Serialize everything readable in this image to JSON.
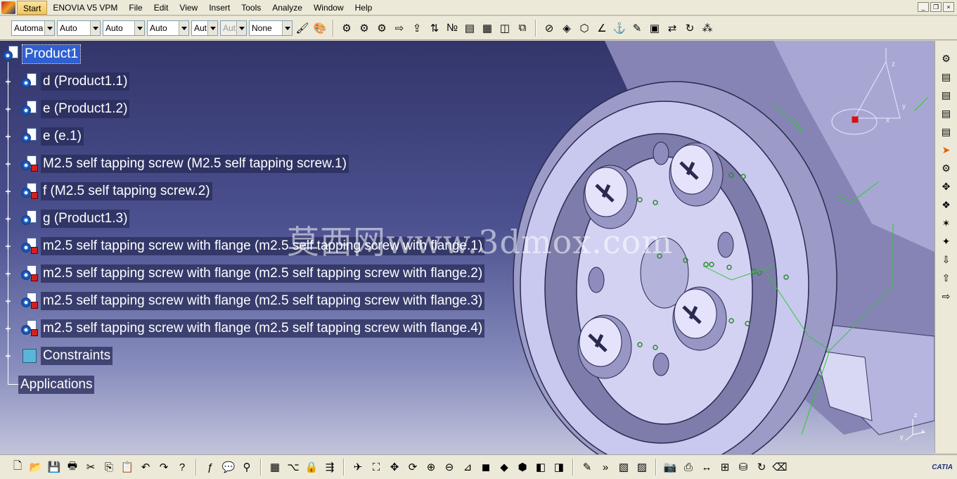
{
  "menu": {
    "start": "Start",
    "items": [
      "ENOVIA V5 VPM",
      "File",
      "Edit",
      "View",
      "Insert",
      "Tools",
      "Analyze",
      "Window",
      "Help"
    ]
  },
  "window_controls": [
    "_",
    "❐",
    "×"
  ],
  "toolbar": {
    "combos": [
      {
        "value": "Automa",
        "disabled": false
      },
      {
        "value": "Auto",
        "disabled": false
      },
      {
        "value": "Auto",
        "disabled": false
      },
      {
        "value": "Auto",
        "disabled": false
      },
      {
        "value": "Aut",
        "disabled": false
      },
      {
        "value": "Aut",
        "disabled": true
      },
      {
        "value": "None",
        "disabled": false
      }
    ]
  },
  "tree": {
    "root": "Product1",
    "children": [
      {
        "label": "d (Product1.1)",
        "icon": "product-icon"
      },
      {
        "label": "e (Product1.2)",
        "icon": "product-icon"
      },
      {
        "label": "e (e.1)",
        "icon": "product-icon"
      },
      {
        "label": "M2.5  self tapping screw (M2.5  self tapping screw.1)",
        "icon": "part-icon"
      },
      {
        "label": "f (M2.5  self tapping screw.2)",
        "icon": "part-icon"
      },
      {
        "label": "g (Product1.3)",
        "icon": "product-icon"
      },
      {
        "label": "m2.5 self tapping screw with flange (m2.5 self tapping screw with flange.1)",
        "icon": "part-icon"
      },
      {
        "label": "m2.5 self tapping screw with flange (m2.5 self tapping screw with flange.2)",
        "icon": "part-icon"
      },
      {
        "label": "m2.5 self tapping screw with flange (m2.5 self tapping screw with flange.3)",
        "icon": "part-icon"
      },
      {
        "label": "m2.5 self tapping screw with flange (m2.5 self tapping screw with flange.4)",
        "icon": "part-icon"
      },
      {
        "label": "Constraints",
        "icon": "constraints-icon"
      },
      {
        "label": "Applications",
        "icon": "none"
      }
    ]
  },
  "watermark": "莫西网www.3dmox.com",
  "compass": {
    "x": "x",
    "y": "y",
    "z": "z"
  },
  "logo": "CATIA",
  "colors": {
    "viewport_top": "#33356a",
    "viewport_bottom": "#c2c4dc",
    "model_face": "#c9c8ee",
    "selection": "#2f5fd0"
  }
}
